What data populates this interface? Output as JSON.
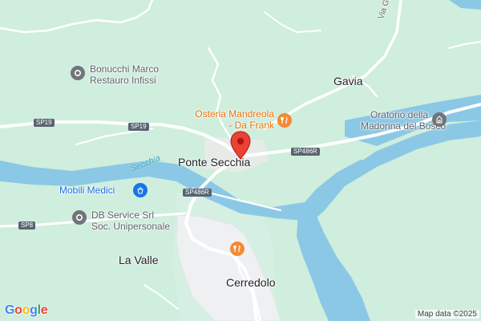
{
  "places": {
    "gavia": "Gavia",
    "ponte_secchia": "Ponte Secchia",
    "la_valle": "La Valle",
    "cerredolo": "Cerredolo"
  },
  "pois": {
    "bonucchi_line1": "Bonucchi Marco",
    "bonucchi_line2": "Restauro Infissi",
    "osteria_line1": "Osteria Mandreola",
    "osteria_line2": "- Da Frank",
    "oratorio_line1": "Oratorio della",
    "oratorio_line2": "Madonna del Bosco",
    "mobili": "Mobili Medici",
    "db_line1": "DB Service Srl",
    "db_line2": "Soc. Unipersonale"
  },
  "roads": {
    "sp19_a": "SP19",
    "sp19_b": "SP19",
    "sp486r_a": "SP486R",
    "sp486r_b": "SP486R",
    "sp8": "SP8",
    "via_gavia": "Via Gavia"
  },
  "river": "Secchia",
  "branding": {
    "logo": "Google",
    "attribution": "Map data ©2025"
  },
  "icons": {
    "bonucchi": "pin-grey-circle",
    "osteria": "restaurant-icon",
    "oratorio": "church-icon",
    "mobili": "shopping-icon",
    "db_service": "pin-grey-circle",
    "cerredolo_restaurant": "restaurant-icon",
    "marker": "red-location-pin"
  },
  "colors": {
    "land": "#cfeedd",
    "water": "#8bc8e6",
    "urban": "#eef0f2",
    "road": "#ffffff",
    "marker": "#ea4335",
    "poi_food": "#f28b35"
  }
}
